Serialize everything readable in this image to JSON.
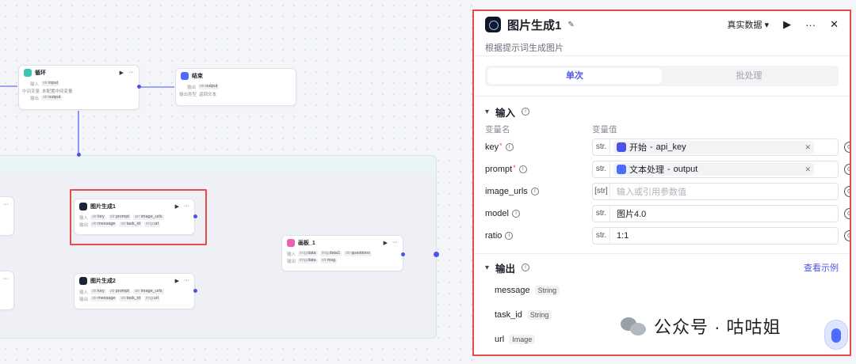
{
  "canvas": {
    "loop_node": {
      "title": "循环",
      "rows": [
        {
          "label": "输入",
          "type": "str",
          "value": "input"
        },
        {
          "label": "中间变量",
          "type": "",
          "value": "未配置中间变量"
        },
        {
          "label": "输出",
          "type": "str",
          "value": "output"
        }
      ]
    },
    "end_node": {
      "title": "结束",
      "rows": [
        {
          "label": "输出",
          "type": "str",
          "value": "output"
        },
        {
          "label": "输出类型",
          "type": "",
          "value": "返回文本"
        }
      ]
    },
    "img_node_1": {
      "title": "图片生成1",
      "inputs_label": "输入",
      "inputs": [
        {
          "type": "str",
          "value": "key"
        },
        {
          "type": "str",
          "value": "prompt"
        },
        {
          "type": "arr",
          "value": "image_urls"
        }
      ],
      "outputs_label": "输出",
      "outputs": [
        {
          "type": "str",
          "value": "message"
        },
        {
          "type": "str",
          "value": "task_id"
        },
        {
          "type": "img",
          "value": "url"
        }
      ]
    },
    "img_node_2": {
      "title": "图片生成2",
      "inputs_label": "输入",
      "inputs": [
        {
          "type": "str",
          "value": "key"
        },
        {
          "type": "str",
          "value": "prompt"
        },
        {
          "type": "arr",
          "value": "image_urls"
        }
      ],
      "outputs_label": "输出",
      "outputs": [
        {
          "type": "str",
          "value": "message"
        },
        {
          "type": "str",
          "value": "task_id"
        },
        {
          "type": "img",
          "value": "url"
        }
      ]
    },
    "board_node": {
      "title": "画板_1",
      "inputs_label": "输入",
      "inputs": [
        {
          "type": "img",
          "value": "data"
        },
        {
          "type": "img",
          "value": "data1"
        },
        {
          "type": "str",
          "value": "questions"
        }
      ],
      "outputs_label": "输出",
      "outputs": [
        {
          "type": "img",
          "value": "data"
        },
        {
          "type": "str",
          "value": "msg"
        }
      ]
    },
    "tools": {
      "run": "▶",
      "more": "···"
    }
  },
  "panel": {
    "title": "图片生成1",
    "description": "根据提示词生成图片",
    "data_mode": "真实数据",
    "mode_tabs": [
      "单次",
      "批处理"
    ],
    "input_section": "输入",
    "col_name": "变量名",
    "col_value": "变量值",
    "params": [
      {
        "name": "key",
        "required": true,
        "type": "str.",
        "ref_node": "开始",
        "ref_var": "api_key",
        "ref_sep": "-"
      },
      {
        "name": "prompt",
        "required": true,
        "type": "str.",
        "ref_node": "文本处理",
        "ref_var": "output",
        "ref_sep": "-"
      },
      {
        "name": "image_urls",
        "required": false,
        "type": "[str]",
        "placeholder": "输入或引用参数值"
      },
      {
        "name": "model",
        "required": false,
        "type": "str.",
        "value": "图片4.0"
      },
      {
        "name": "ratio",
        "required": false,
        "type": "str.",
        "value": "1:1"
      }
    ],
    "output_section": "输出",
    "output_link": "查看示例",
    "outputs": [
      {
        "name": "message",
        "type": "String"
      },
      {
        "name": "task_id",
        "type": "String"
      },
      {
        "name": "url",
        "type": "Image"
      }
    ]
  },
  "watermark": {
    "text": "公众号 · 咕咕姐"
  },
  "colors": {
    "accent": "#4d53e8",
    "highlight": "#ec4a4a",
    "required": "#ec4a4a"
  }
}
